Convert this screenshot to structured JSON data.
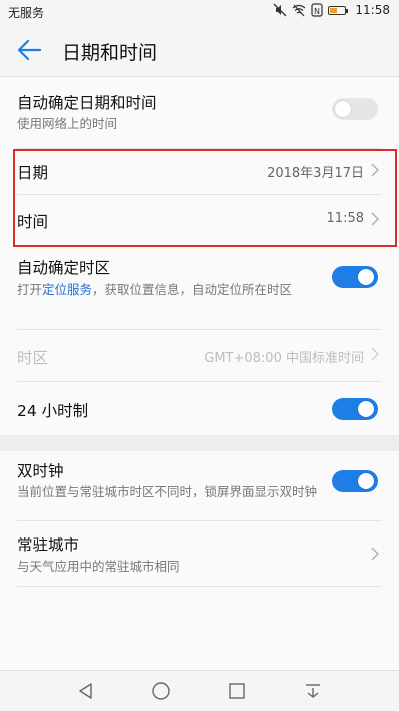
{
  "status": {
    "carrier": "无服务",
    "time": "11:58"
  },
  "header": {
    "title": "日期和时间"
  },
  "settings": {
    "auto_datetime": {
      "label": "自动确定日期和时间",
      "sub": "使用网络上的时间",
      "enabled": false
    },
    "date": {
      "label": "日期",
      "value": "2018年3月17日"
    },
    "time": {
      "label": "时间",
      "value": "11:58"
    },
    "auto_timezone": {
      "label": "自动确定时区",
      "sub_prefix": "打开",
      "sub_link": "定位服务",
      "sub_suffix": "，获取位置信息，自动定位所在时区",
      "enabled": true
    },
    "timezone": {
      "label": "时区",
      "value": "GMT+08:00 中国标准时间"
    },
    "hour24": {
      "label": "24 小时制",
      "enabled": true
    },
    "dual_clock": {
      "label": "双时钟",
      "sub": "当前位置与常驻城市时区不同时，锁屏界面显示双时钟",
      "enabled": true
    },
    "home_city": {
      "label": "常驻城市",
      "sub": "与天气应用中的常驻城市相同"
    }
  },
  "colors": {
    "accent": "#1f7de6",
    "highlight": "#e02a2a"
  }
}
